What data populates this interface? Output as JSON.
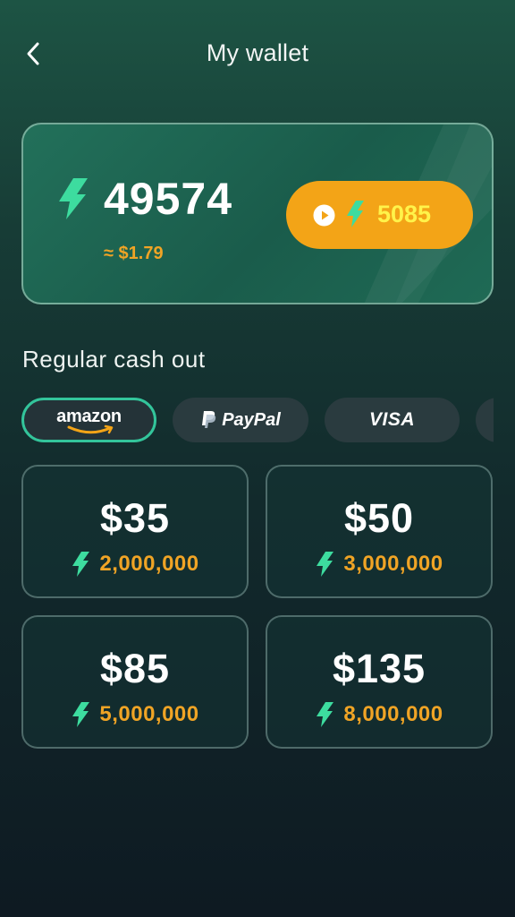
{
  "header": {
    "title": "My wallet",
    "back_icon": "chevron-left-icon"
  },
  "wallet": {
    "balance": "49574",
    "balance_icon": "lightning-bolt-icon",
    "approx_value": "≈ $1.79",
    "reward_button": {
      "value": "5085",
      "icons": [
        "play-icon",
        "lightning-bolt-icon"
      ]
    }
  },
  "cashout": {
    "section_title": "Regular cash out",
    "methods": [
      {
        "label": "amazon",
        "selected": true
      },
      {
        "label": "PayPal",
        "selected": false
      },
      {
        "label": "VISA",
        "selected": false
      }
    ],
    "offers": [
      {
        "amount": "$35",
        "cost": "2,000,000"
      },
      {
        "amount": "$50",
        "cost": "3,000,000"
      },
      {
        "amount": "$85",
        "cost": "5,000,000"
      },
      {
        "amount": "$135",
        "cost": "8,000,000"
      }
    ]
  },
  "colors": {
    "accent_green": "#33c59b",
    "bolt_green": "#3ddc9f",
    "orange": "#f3a417",
    "gold_text": "#f0a425",
    "yellow_text": "#fff34a"
  }
}
